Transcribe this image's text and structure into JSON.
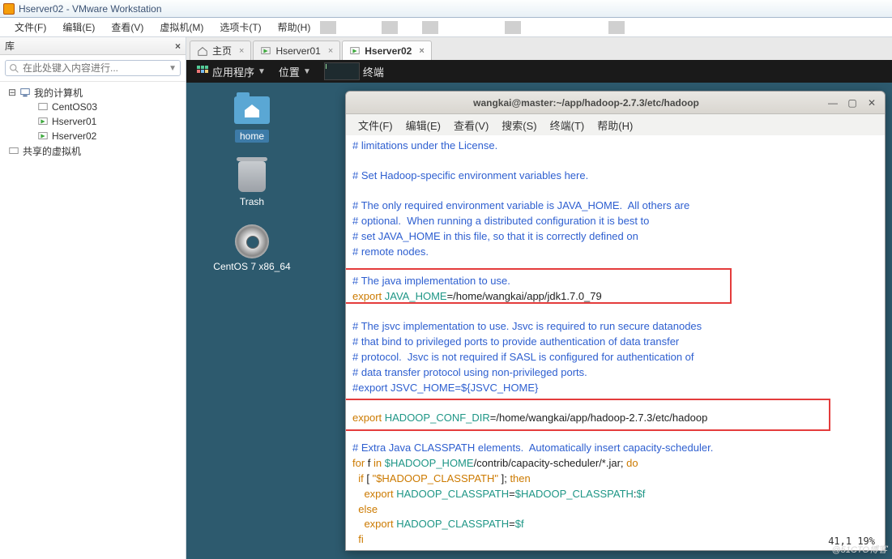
{
  "window": {
    "title": "Hserver02 - VMware Workstation"
  },
  "menubar": {
    "file": "文件(F)",
    "edit": "编辑(E)",
    "view": "查看(V)",
    "vm": "虚拟机(M)",
    "tabs": "选项卡(T)",
    "help": "帮助(H)"
  },
  "library": {
    "title": "库",
    "search_placeholder": "在此处键入内容进行...",
    "root": "我的计算机",
    "items": [
      "CentOS03",
      "Hserver01",
      "Hserver02"
    ],
    "shared": "共享的虚拟机"
  },
  "vmtabs": {
    "home": "主页",
    "t1": "Hserver01",
    "t2": "Hserver02"
  },
  "guestbar": {
    "apps": "应用程序",
    "places": "位置",
    "terminal": "终端"
  },
  "desktop": {
    "home": "home",
    "trash": "Trash",
    "disc": "CentOS 7 x86_64"
  },
  "terminal": {
    "title": "wangkai@master:~/app/hadoop-2.7.3/etc/hadoop",
    "menus": {
      "file": "文件(F)",
      "edit": "编辑(E)",
      "view": "查看(V)",
      "search": "搜索(S)",
      "term": "终端(T)",
      "help": "帮助(H)"
    },
    "lines": {
      "l1": "# limitations under the License.",
      "l3": "# Set Hadoop-specific environment variables here.",
      "l5": "# The only required environment variable is JAVA_HOME.  All others are",
      "l6": "# optional.  When running a distributed configuration it is best to",
      "l7": "# set JAVA_HOME in this file, so that it is correctly defined on",
      "l8": "# remote nodes.",
      "l10": "# The java implementation to use.",
      "l11a": "export",
      "l11b": " JAVA_HOME",
      "l11c": "=",
      "l11d": "/home/wangkai/app/jdk1.7.0_79",
      "l13": "# The jsvc implementation to use. Jsvc is required to run secure datanodes",
      "l14": "# that bind to privileged ports to provide authentication of data transfer",
      "l15": "# protocol.  Jsvc is not required if SASL is configured for authentication of",
      "l16": "# data transfer protocol using non-privileged ports.",
      "l17": "#export JSVC_HOME=${JSVC_HOME}",
      "l19a": "export",
      "l19b": " HADOOP_CONF_DIR",
      "l19c": "=",
      "l19d": "/home/wangkai/app/hadoop-2.7.3/etc/hadoop",
      "l21": "# Extra Java CLASSPATH elements.  Automatically insert capacity-scheduler.",
      "l22a": "for",
      "l22b": " f ",
      "l22c": "in",
      "l22d": " $HADOOP_HOME",
      "l22e": "/contrib/capacity-scheduler/*.jar; ",
      "l22f": "do",
      "l23a": "  if",
      "l23b": " [ ",
      "l23c": "\"$HADOOP_CLASSPATH\"",
      "l23d": " ]; ",
      "l23e": "then",
      "l24a": "    export",
      "l24b": " HADOOP_CLASSPATH",
      "l24c": "=",
      "l24d": "$HADOOP_CLASSPATH",
      "l24e": ":",
      "l24f": "$f",
      "l25": "  else",
      "l26a": "    export",
      "l26b": " HADOOP_CLASSPATH",
      "l26c": "=",
      "l26d": "$f",
      "l27": "  fi"
    },
    "status": "41,1          19%"
  },
  "watermark": "@51CTO博客"
}
